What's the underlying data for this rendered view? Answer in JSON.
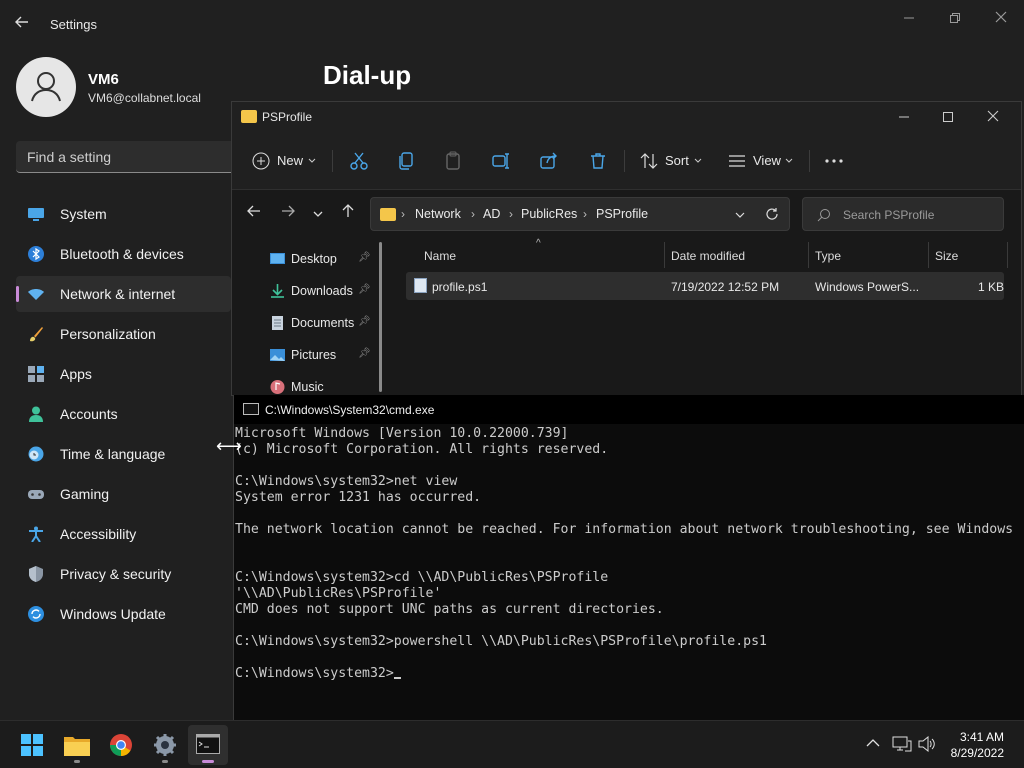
{
  "settings": {
    "title": "Settings",
    "user": {
      "name": "VM6",
      "email": "VM6@collabnet.local"
    },
    "search_placeholder": "Find a setting",
    "page_heading": "Dial-up",
    "nav": [
      {
        "label": "System",
        "icon": "display-icon"
      },
      {
        "label": "Bluetooth & devices",
        "icon": "bluetooth-icon"
      },
      {
        "label": "Network & internet",
        "icon": "wifi-icon",
        "active": true
      },
      {
        "label": "Personalization",
        "icon": "brush-icon"
      },
      {
        "label": "Apps",
        "icon": "apps-icon"
      },
      {
        "label": "Accounts",
        "icon": "person-icon"
      },
      {
        "label": "Time & language",
        "icon": "clock-globe-icon"
      },
      {
        "label": "Gaming",
        "icon": "gamepad-icon"
      },
      {
        "label": "Accessibility",
        "icon": "accessibility-icon"
      },
      {
        "label": "Privacy & security",
        "icon": "shield-icon"
      },
      {
        "label": "Windows Update",
        "icon": "update-icon"
      }
    ]
  },
  "explorer": {
    "title": "PSProfile",
    "toolbar": {
      "new_label": "New",
      "sort_label": "Sort",
      "view_label": "View"
    },
    "breadcrumb": [
      "Network",
      "AD",
      "PublicRes",
      "PSProfile"
    ],
    "search_placeholder": "Search PSProfile",
    "nav_pane": [
      {
        "label": "Desktop",
        "pinned": true
      },
      {
        "label": "Downloads",
        "pinned": true
      },
      {
        "label": "Documents",
        "pinned": true
      },
      {
        "label": "Pictures",
        "pinned": true
      },
      {
        "label": "Music",
        "pinned": false
      }
    ],
    "columns": [
      "Name",
      "Date modified",
      "Type",
      "Size"
    ],
    "files": [
      {
        "name": "profile.ps1",
        "date_modified": "7/19/2022 12:52 PM",
        "type": "Windows PowerS...",
        "size": "1 KB"
      }
    ]
  },
  "cmd": {
    "title": "C:\\Windows\\System32\\cmd.exe",
    "lines": [
      "Microsoft Windows [Version 10.0.22000.739]",
      "(c) Microsoft Corporation. All rights reserved.",
      "",
      "C:\\Windows\\system32>net view",
      "System error 1231 has occurred.",
      "",
      "The network location cannot be reached. For information about network troubleshooting, see Windows",
      "",
      "",
      "C:\\Windows\\system32>cd \\\\AD\\PublicRes\\PSProfile",
      "'\\\\AD\\PublicRes\\PSProfile'",
      "CMD does not support UNC paths as current directories.",
      "",
      "C:\\Windows\\system32>powershell \\\\AD\\PublicRes\\PSProfile\\profile.ps1",
      "",
      "C:\\Windows\\system32>"
    ]
  },
  "taskbar": {
    "apps": [
      "start-icon",
      "file-explorer-icon",
      "chrome-icon",
      "settings-icon",
      "cmd-icon"
    ],
    "time": "3:41 AM",
    "date": "8/29/2022"
  },
  "colors": {
    "accent": "#c98bd8",
    "folder": "#f4c64a",
    "window_bg": "#202020",
    "console_bg": "#0c0c0c"
  }
}
